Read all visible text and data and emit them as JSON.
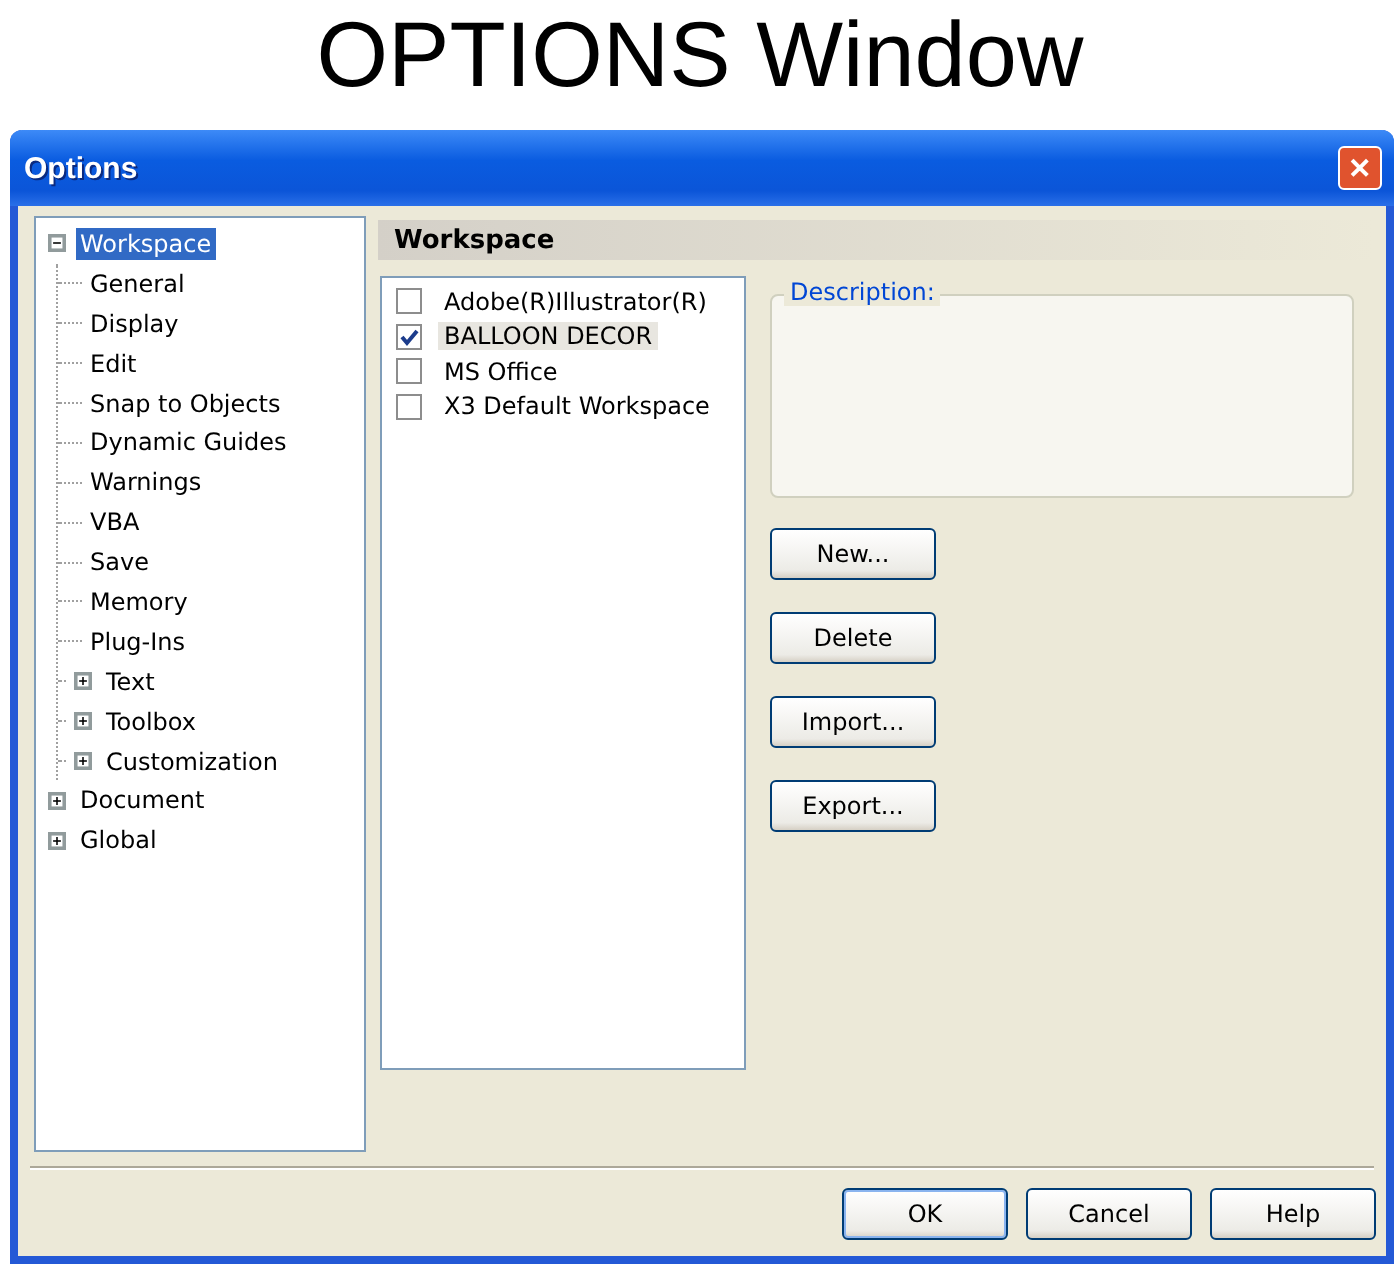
{
  "page_title": "OPTIONS Window",
  "window": {
    "title": "Options",
    "close": "✕"
  },
  "tree": [
    {
      "label": "Workspace",
      "kind": "node",
      "expanded": true,
      "selected": true,
      "children": [
        {
          "label": "General",
          "kind": "leaf",
          "selected": false
        },
        {
          "label": "Display",
          "kind": "leaf",
          "selected": false
        },
        {
          "label": "Edit",
          "kind": "leaf",
          "selected": false
        },
        {
          "label": "Snap to Objects",
          "kind": "leaf",
          "selected": false
        },
        {
          "label": "Dynamic Guides",
          "kind": "leaf",
          "selected": false
        },
        {
          "label": "Warnings",
          "kind": "leaf",
          "selected": false
        },
        {
          "label": "VBA",
          "kind": "leaf",
          "selected": false
        },
        {
          "label": "Save",
          "kind": "leaf",
          "selected": false
        },
        {
          "label": "Memory",
          "kind": "leaf",
          "selected": false
        },
        {
          "label": "Plug-Ins",
          "kind": "leaf",
          "selected": false
        },
        {
          "label": "Text",
          "kind": "node",
          "expanded": false,
          "selected": false
        },
        {
          "label": "Toolbox",
          "kind": "node",
          "expanded": false,
          "selected": false
        },
        {
          "label": "Customization",
          "kind": "node",
          "expanded": false,
          "selected": false
        }
      ]
    },
    {
      "label": "Document",
      "kind": "node",
      "expanded": false,
      "selected": false
    },
    {
      "label": "Global",
      "kind": "node",
      "expanded": false,
      "selected": false
    }
  ],
  "panel": {
    "title": "Workspace",
    "workspaces": [
      {
        "label": "Adobe(R)Illustrator(R)",
        "checked": false,
        "selected": false
      },
      {
        "label": "BALLOON DECOR",
        "checked": true,
        "selected": true
      },
      {
        "label": "MS Office",
        "checked": false,
        "selected": false
      },
      {
        "label": "X3 Default Workspace",
        "checked": false,
        "selected": false
      }
    ],
    "description": {
      "label": "Description:"
    },
    "buttons": [
      "New...",
      "Delete",
      "Import...",
      "Export..."
    ]
  },
  "footer_buttons": [
    {
      "label": "OK",
      "default": true
    },
    {
      "label": "Cancel",
      "default": false
    },
    {
      "label": "Help",
      "default": false
    }
  ]
}
